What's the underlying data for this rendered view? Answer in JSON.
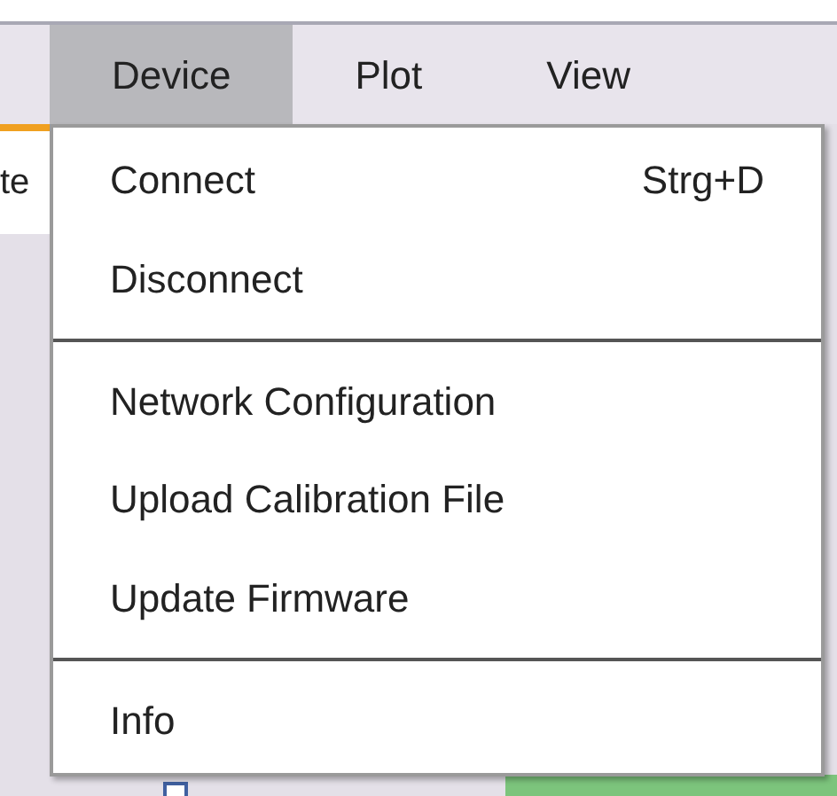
{
  "menu_bar": [
    {
      "label": "Device",
      "selected": true
    },
    {
      "label": "Plot",
      "selected": false
    },
    {
      "label": "View",
      "selected": false
    }
  ],
  "background_text": "te",
  "menu": [
    {
      "kind": "item",
      "label": "Connect",
      "shortcut": "Strg+D"
    },
    {
      "kind": "item",
      "label": "Disconnect"
    },
    {
      "kind": "separator"
    },
    {
      "kind": "item",
      "label": "Network Configuration"
    },
    {
      "kind": "item",
      "label": "Upload Calibration File"
    },
    {
      "kind": "item",
      "label": "Update Firmware"
    },
    {
      "kind": "separator"
    },
    {
      "kind": "item",
      "label": "Info"
    }
  ]
}
